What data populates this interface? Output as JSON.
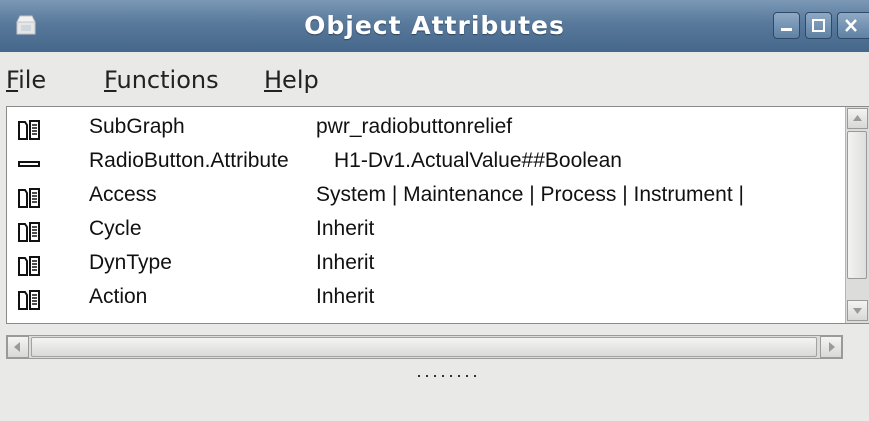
{
  "window": {
    "title": "Object Attributes",
    "icons": {
      "app": "app-icon",
      "minimize": "minimize-icon",
      "maximize": "maximize-icon",
      "close": "close-icon"
    }
  },
  "menu": [
    {
      "mnemonic": "F",
      "rest": "ile"
    },
    {
      "mnemonic": "F",
      "rest": "unctions"
    },
    {
      "mnemonic": "H",
      "rest": "elp"
    }
  ],
  "attributes": [
    {
      "icon": "folder-icon",
      "name": "SubGraph",
      "value": "pwr_radiobuttonrelief"
    },
    {
      "icon": "dash-icon",
      "name": "RadioButton.Attribute",
      "value": "H1-Dv1.ActualValue##Boolean"
    },
    {
      "icon": "folder-icon",
      "name": "Access",
      "value": "System | Maintenance | Process | Instrument |"
    },
    {
      "icon": "folder-icon",
      "name": "Cycle",
      "value": "Inherit"
    },
    {
      "icon": "folder-icon",
      "name": "DynType",
      "value": "Inherit"
    },
    {
      "icon": "folder-icon",
      "name": "Action",
      "value": "Inherit"
    }
  ],
  "colors": {
    "titlebar": "#58799b",
    "title_text": "#ffffff",
    "list_bg": "#ffffff",
    "window_bg": "#e9e9e7"
  }
}
